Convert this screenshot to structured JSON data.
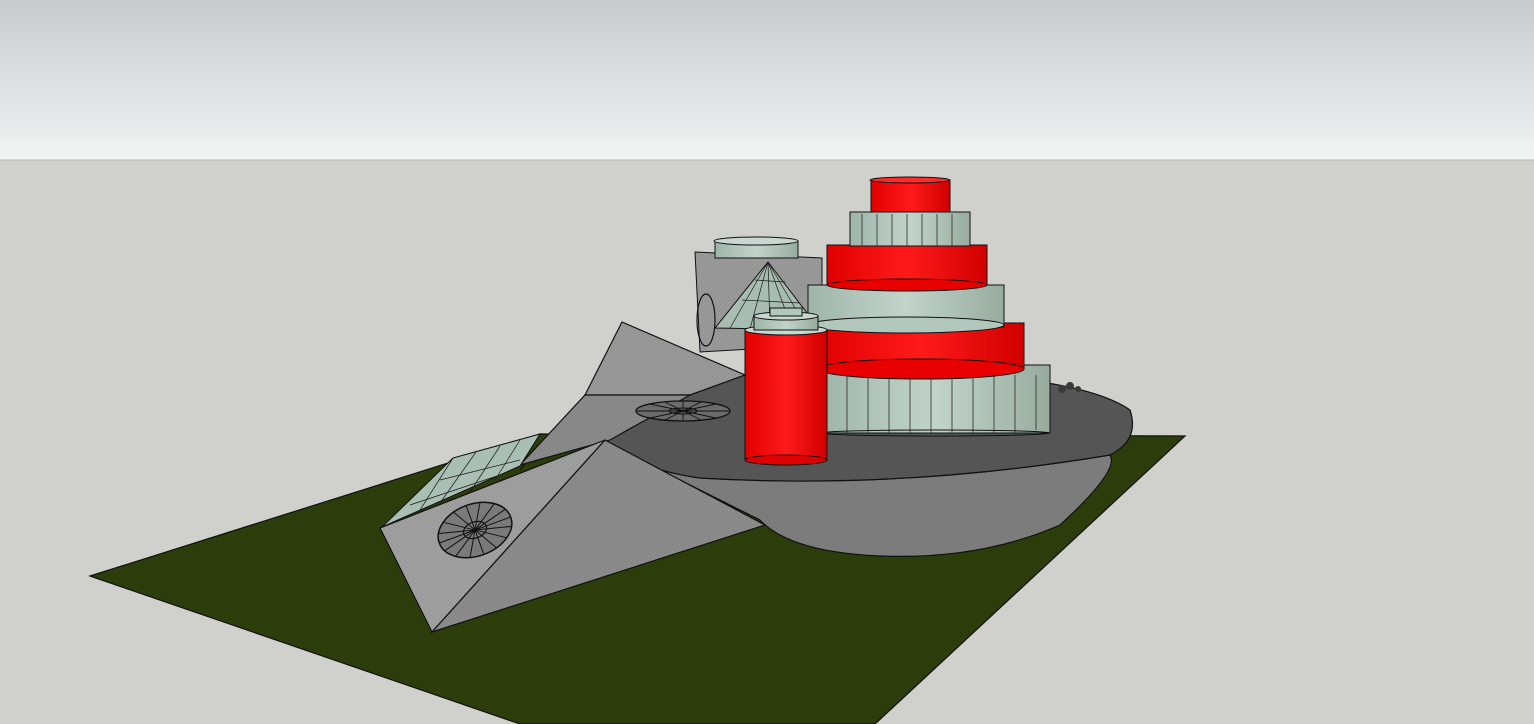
{
  "viewport": {
    "sky_color_top": "#c9ccce",
    "sky_color_bottom": "#f1f2f2",
    "ground_color": "#cfcfcb",
    "grass_color": "#2c3d0a",
    "accent_red": "#f00000",
    "glass_color": "#b3c8bc",
    "stone_color": "#8f8f8f",
    "dark_stone_color": "#555555",
    "edge_color": "#111111"
  },
  "model": {
    "description_icons": [
      "rose-window-icon"
    ]
  }
}
